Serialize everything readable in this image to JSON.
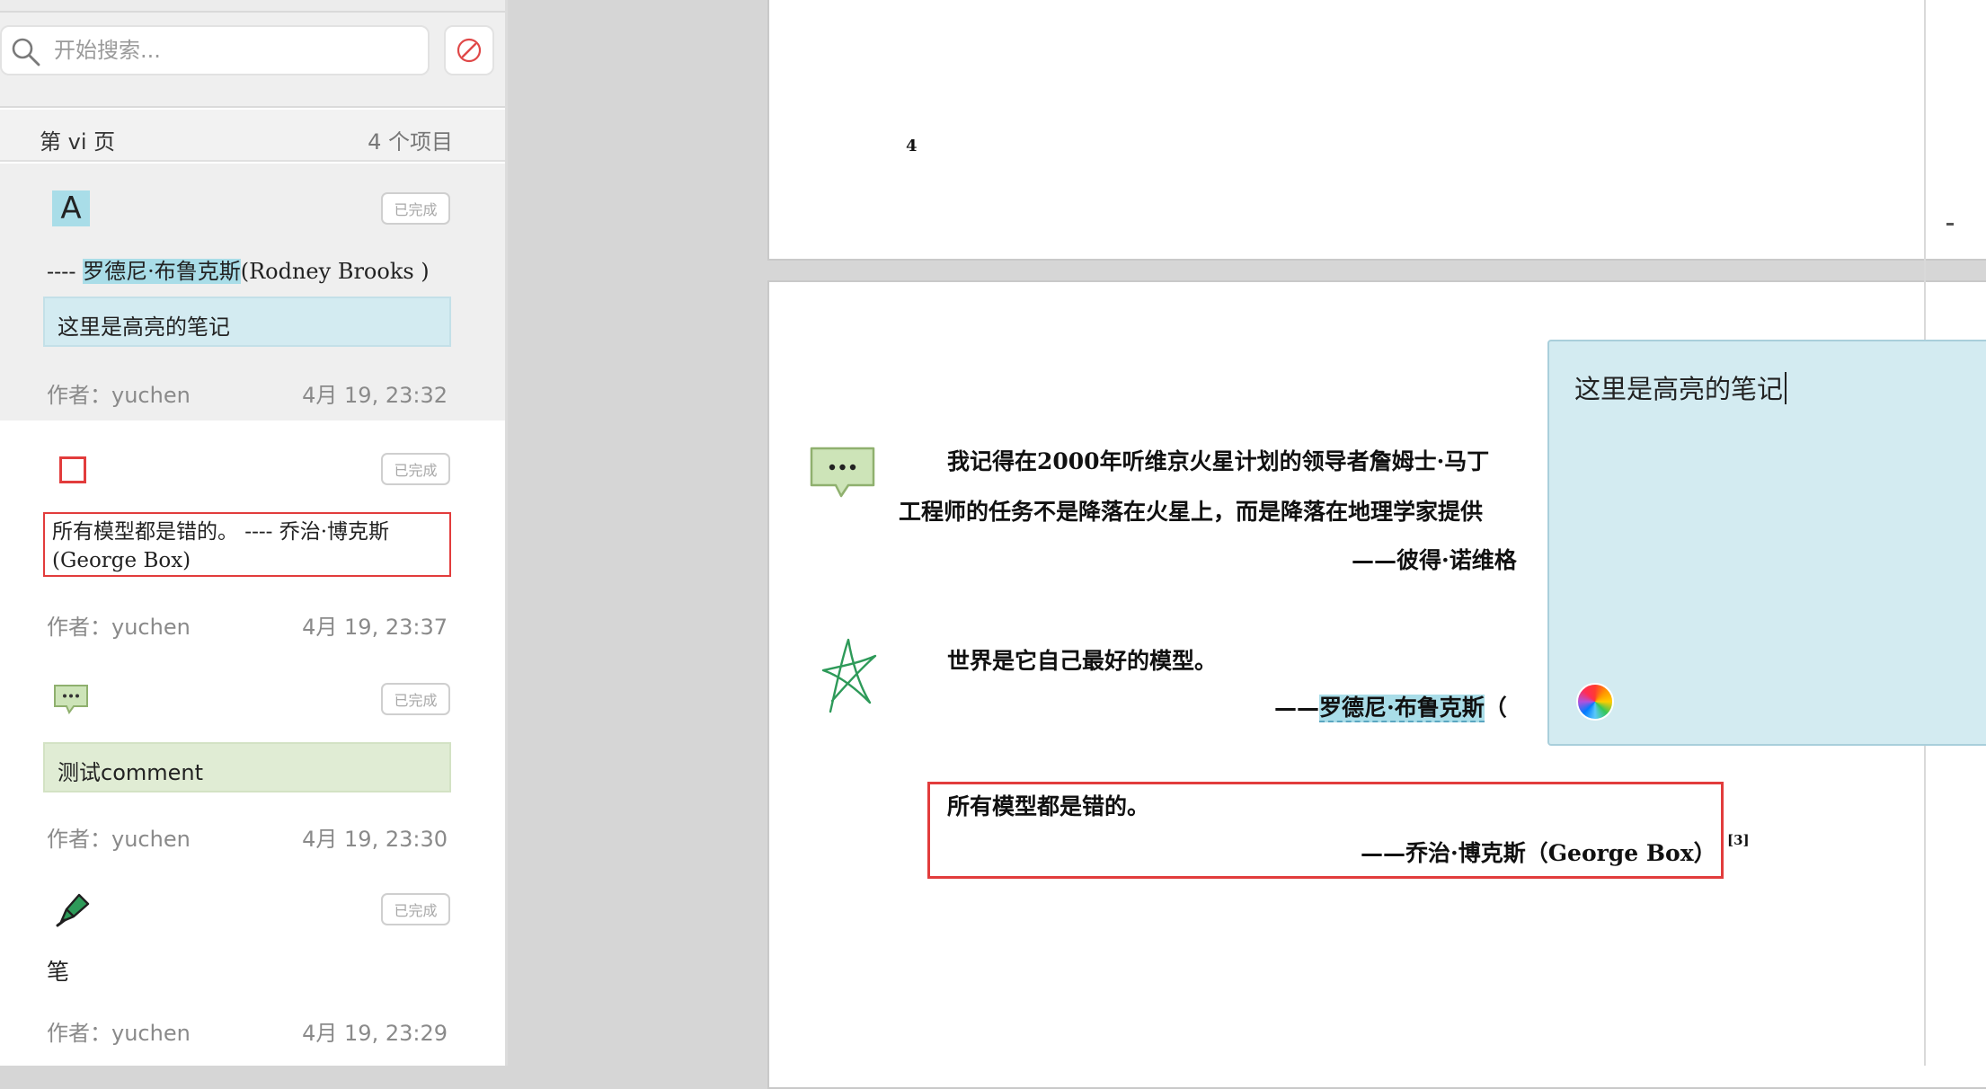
{
  "search": {
    "placeholder": "开始搜索..."
  },
  "section": {
    "title": "第 vi 页",
    "count": "4 个项目"
  },
  "annotations": [
    {
      "type": "highlight",
      "icon": "text-highlight-icon",
      "status": "已完成",
      "text_prefix": "---- ",
      "text_highlight": "罗德尼·布鲁克斯",
      "text_suffix": "(Rodney Brooks )",
      "note": "这里是高亮的笔记",
      "author": "作者：yuchen",
      "date": "4月 19, 23:32"
    },
    {
      "type": "rectangle",
      "icon": "square-icon",
      "status": "已完成",
      "text": "所有模型都是错的。 ---- 乔治·博克斯 (George Box)",
      "author": "作者：yuchen",
      "date": "4月 19, 23:37"
    },
    {
      "type": "comment",
      "icon": "comment-bubble-icon",
      "status": "已完成",
      "note": "测试comment",
      "author": "作者：yuchen",
      "date": "4月 19, 23:30"
    },
    {
      "type": "pen",
      "icon": "pen-icon",
      "status": "已完成",
      "text": "笔",
      "author": "作者：yuchen",
      "date": "4月 19, 23:29"
    }
  ],
  "document": {
    "page1_number": "4",
    "quote1_line1": "我记得在2000年听维京火星计划的领导者詹姆士·马丁",
    "quote1_line2": "工程师的任务不是降落在火星上，而是降落在地理学家提供",
    "quote1_author": "——彼得·诺维格",
    "quote2_line1": "世界是它自己最好的模型。",
    "quote2_dash": "——",
    "quote2_author_hl": "罗德尼·布鲁克斯",
    "quote2_author_tail": "（",
    "quote3_line1": "所有模型都是错的。",
    "quote3_author": "——乔治·博克斯（George Box）",
    "quote3_ref": "[3]"
  },
  "popup_note": {
    "text": "这里是高亮的笔记"
  },
  "colors": {
    "highlight": "#a9dde8",
    "note_bg": "#d3ebf1",
    "comment_bg": "#e0ecd4",
    "rect_red": "#e23c3c"
  }
}
